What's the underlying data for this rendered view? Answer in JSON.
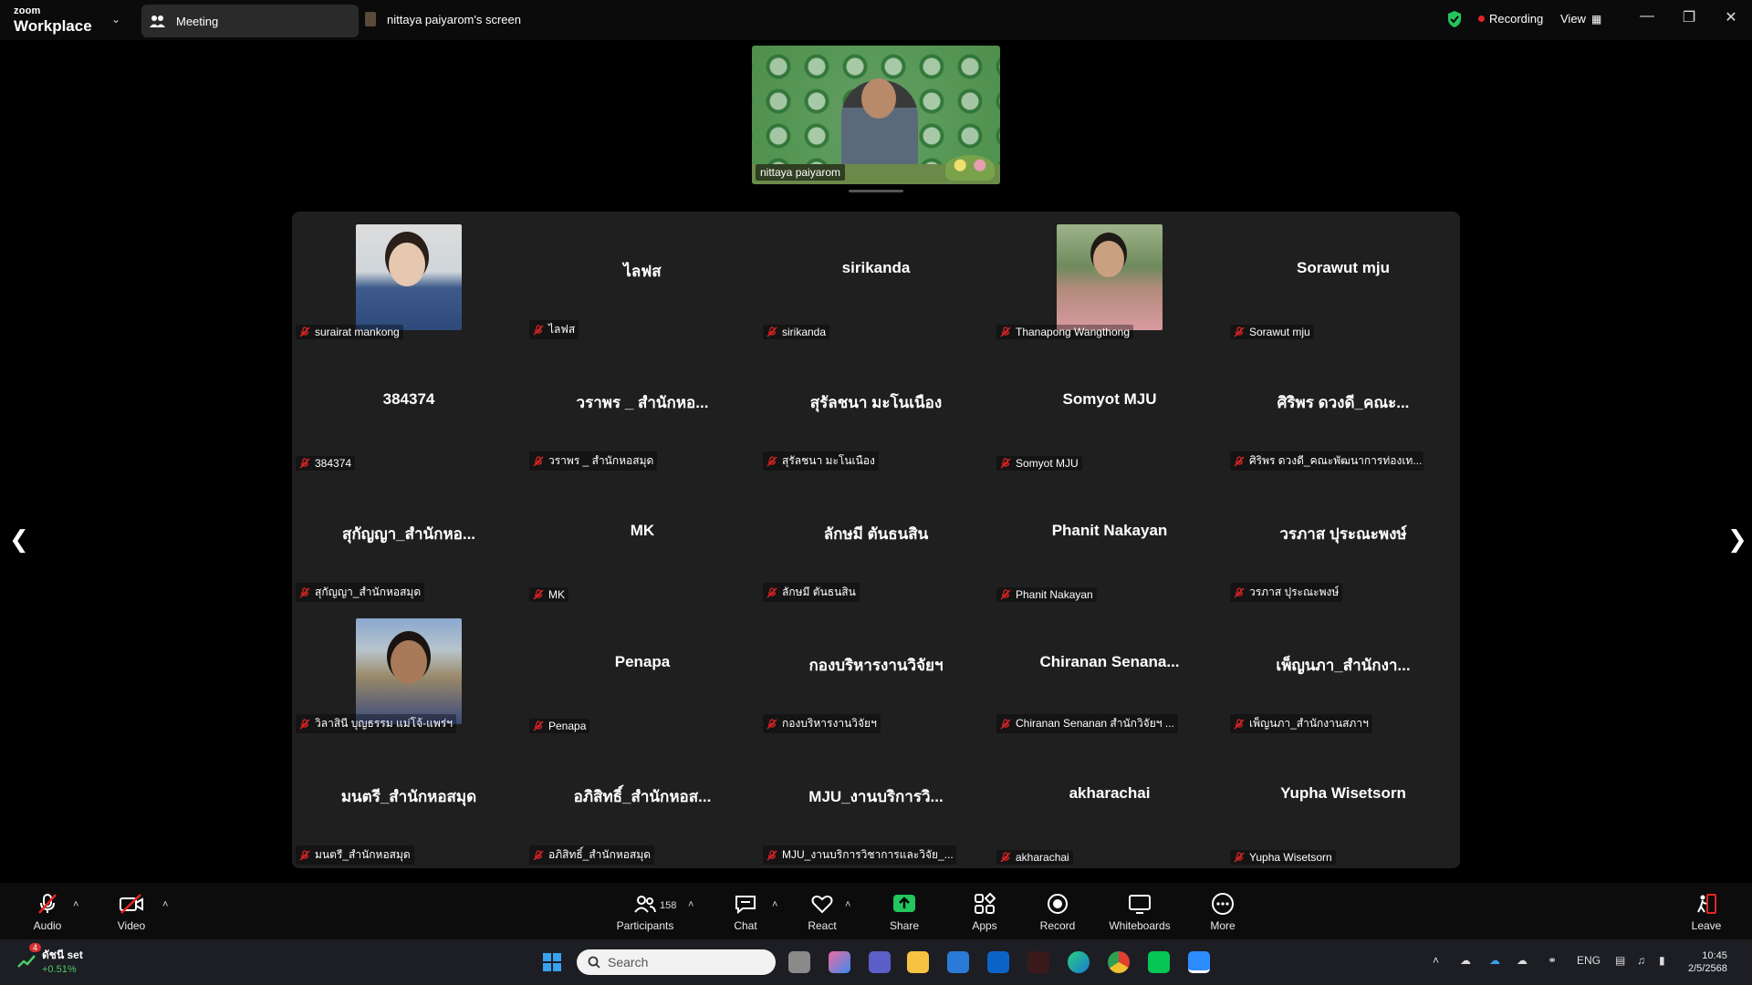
{
  "titlebar": {
    "brand_line1": "zoom",
    "brand_line2": "Workplace",
    "meeting_tab": "Meeting",
    "screen_tab": "nittaya paiyarom's screen",
    "recording": "Recording",
    "view": "View"
  },
  "spotlight": {
    "name": "nittaya paiyarom"
  },
  "tiles": [
    {
      "big": "",
      "label": "surairat mankong",
      "photo": true
    },
    {
      "big": "ไลฟส",
      "label": "ไลฟส"
    },
    {
      "big": "sirikanda",
      "label": "sirikanda"
    },
    {
      "big": "",
      "label": "Thanapong Wangthong",
      "photo": true
    },
    {
      "big": "Sorawut  mju",
      "label": "Sorawut  mju"
    },
    {
      "big": "384374",
      "label": "384374"
    },
    {
      "big": "วราพร _ สำนักหอ...",
      "label": "วราพร _ สำนักหอสมุด"
    },
    {
      "big": "สุรัลชนา มะโนเนือง",
      "label": "สุรัลชนา มะโนเนือง"
    },
    {
      "big": "Somyot MJU",
      "label": "Somyot MJU"
    },
    {
      "big": "ศิริพร ดวงดี_คณะ...",
      "label": "ศิริพร ดวงดี_คณะพัฒนาการท่องเท..."
    },
    {
      "big": "สุกัญญา_สำนักหอ...",
      "label": "สุกัญญา_สำนักหอสมุด"
    },
    {
      "big": "MK",
      "label": "MK"
    },
    {
      "big": "ลักษมี ตันธนสิน",
      "label": "ลักษมี ตันธนสิน"
    },
    {
      "big": "Phanit Nakayan",
      "label": "Phanit Nakayan"
    },
    {
      "big": "วรภาส ปุระณะพงษ์",
      "label": "วรภาส ปุระณะพงษ์"
    },
    {
      "big": "",
      "label": "วิลาสินี บุญธรรม แม่โจ้-แพร่ฯ",
      "photo": true
    },
    {
      "big": "Penapa",
      "label": "Penapa"
    },
    {
      "big": "กองบริหารงานวิจัยฯ",
      "label": "กองบริหารงานวิจัยฯ"
    },
    {
      "big": "Chiranan  Senana...",
      "label": "Chiranan Senanan สำนักวิจัยฯ ..."
    },
    {
      "big": "เพ็ญนภา_สำนักงา...",
      "label": "เพ็ญนภา_สำนักงานสภาฯ"
    },
    {
      "big": "มนตรี_สำนักหอสมุด",
      "label": "มนตรี_สำนักหอสมุด"
    },
    {
      "big": "อภิสิทธิ์_สำนักหอส...",
      "label": "อภิสิทธิ์_สำนักหอสมุด"
    },
    {
      "big": "MJU_งานบริการวิ...",
      "label": "MJU_งานบริการวิชาการและวิจัย_..."
    },
    {
      "big": "akharachai",
      "label": "akharachai"
    },
    {
      "big": "Yupha Wisetsorn",
      "label": "Yupha Wisetsorn"
    }
  ],
  "toolbar": {
    "audio": "Audio",
    "video": "Video",
    "participants": "Participants",
    "participants_count": "158",
    "chat": "Chat",
    "react": "React",
    "share": "Share",
    "apps": "Apps",
    "record": "Record",
    "whiteboards": "Whiteboards",
    "more": "More",
    "leave": "Leave"
  },
  "taskbar": {
    "stock_name": "ดัชนี set",
    "stock_change": "+0.51%",
    "stock_badge": "4",
    "search_placeholder": "Search",
    "lang": "ENG",
    "time": "10:45",
    "date": "2/5/2568"
  },
  "colors": {
    "accent_green": "#22c55e",
    "recording_red": "#e52424",
    "gallery_bg": "#1f1f1f"
  }
}
